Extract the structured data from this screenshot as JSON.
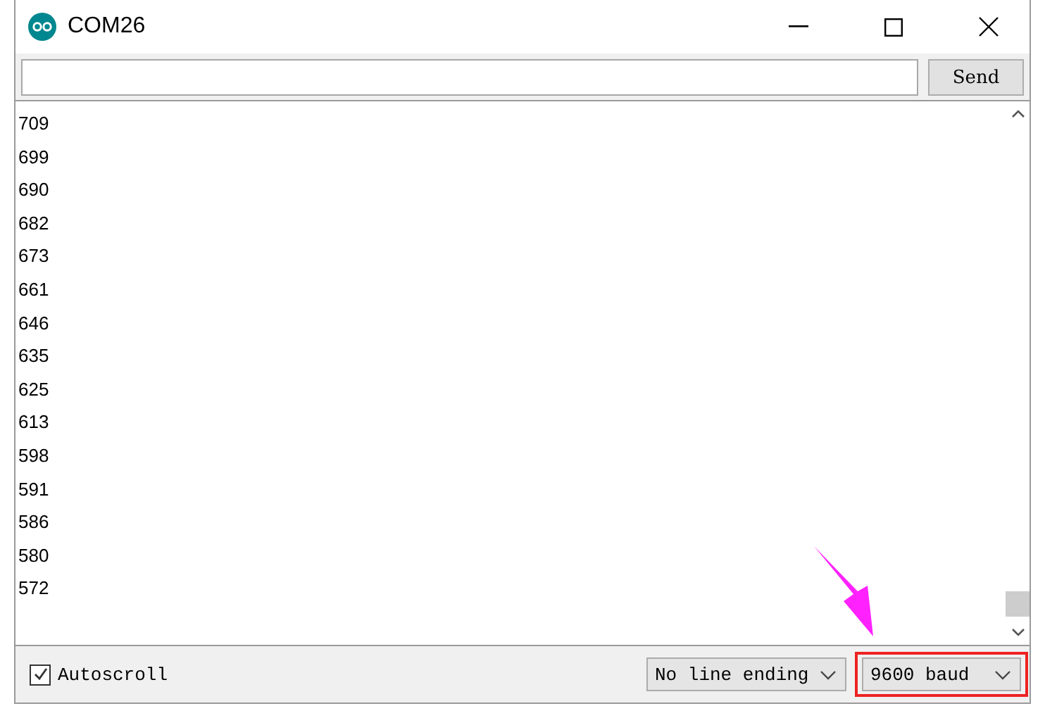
{
  "window": {
    "title": "COM26"
  },
  "send_button": "Send",
  "output_lines": [
    "709",
    "699",
    "690",
    "682",
    "673",
    "661",
    "646",
    "635",
    "625",
    "613",
    "598",
    "591",
    "586",
    "580",
    "572"
  ],
  "autoscroll": {
    "label": "Autoscroll",
    "checked": true
  },
  "line_ending": "No line ending",
  "baud": {
    "value": "9600 baud",
    "highlighted": true
  }
}
